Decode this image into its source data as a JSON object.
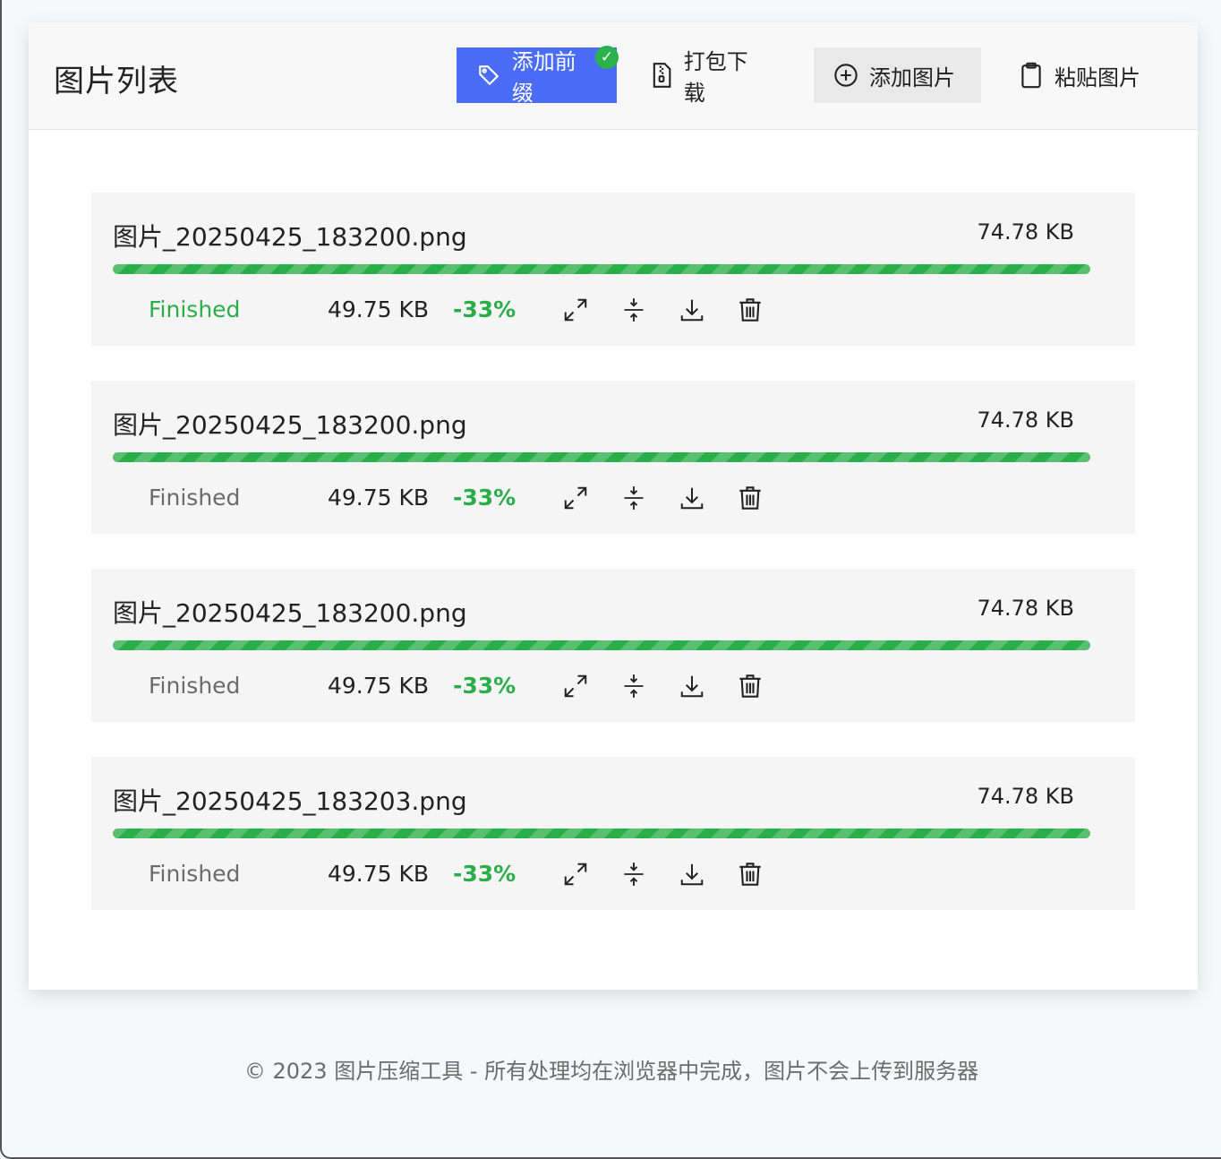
{
  "header": {
    "title": "图片列表",
    "buttons": {
      "add_prefix": "添加前缀",
      "zip_download": "打包下载",
      "add_image": "添加图片",
      "paste_image": "粘贴图片"
    }
  },
  "items": [
    {
      "name": "图片_20250425_183200.png",
      "size": "74.78 KB",
      "status": "Finished",
      "new_size": "49.75 KB",
      "ratio": "-33%",
      "progress": 1.0
    },
    {
      "name": "图片_20250425_183200.png",
      "size": "74.78 KB",
      "status": "Finished",
      "new_size": "49.75 KB",
      "ratio": "-33%",
      "progress": 1.0
    },
    {
      "name": "图片_20250425_183200.png",
      "size": "74.78 KB",
      "status": "Finished",
      "new_size": "49.75 KB",
      "ratio": "-33%",
      "progress": 1.0
    },
    {
      "name": "图片_20250425_183203.png",
      "size": "74.78 KB",
      "status": "Finished",
      "new_size": "49.75 KB",
      "ratio": "-33%",
      "progress": 1.0
    }
  ],
  "item_actions": [
    "expand-icon",
    "compress-icon",
    "download-icon",
    "trash-icon"
  ],
  "footer": {
    "text": "© 2023 图片压缩工具 - 所有处理均在浏览器中完成，图片不会上传到服务器"
  },
  "colors": {
    "primary": "#4a6cf7",
    "success": "#2bae4a",
    "muted": "#6b6b6b"
  }
}
